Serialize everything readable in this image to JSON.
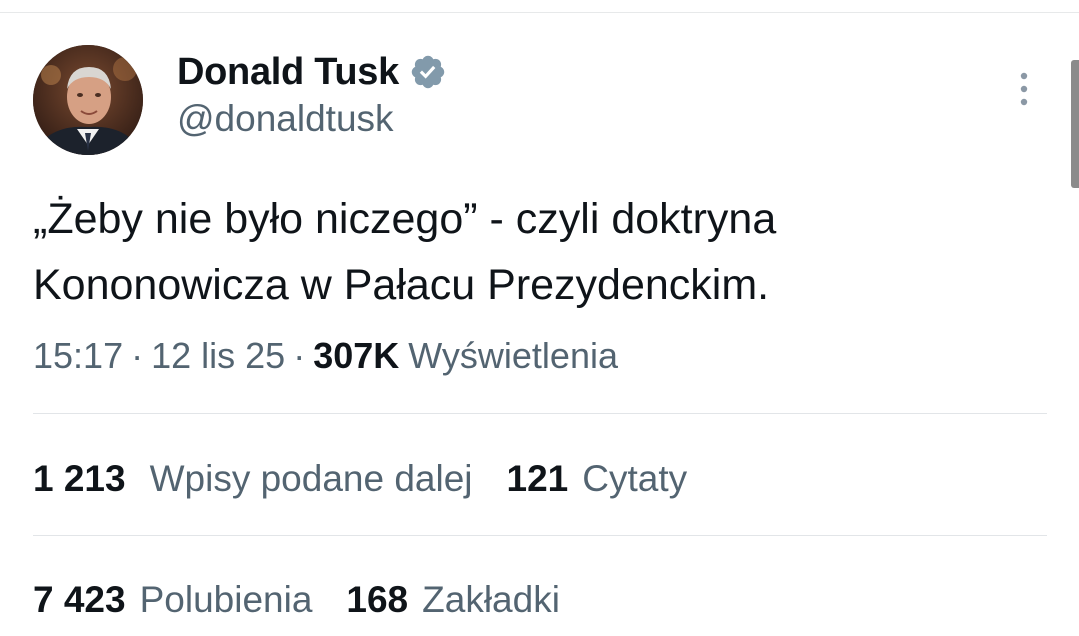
{
  "author": {
    "display_name": "Donald Tusk",
    "handle": "@donaldtusk",
    "verified_icon": "verified-badge-icon",
    "avatar_icon": "avatar-photo"
  },
  "tweet": {
    "text": "„Żeby nie było niczego” - czyli doktryna Kononowicza w Pałacu Prezydenckim."
  },
  "meta": {
    "time": "15:17",
    "separator": "·",
    "date": "12 lis 25",
    "views_count": "307K",
    "views_label": "Wyświetlenia"
  },
  "stats": {
    "reposts_count": "1 213",
    "reposts_label": "Wpisy podane dalej",
    "quotes_count": "121",
    "quotes_label": "Cytaty",
    "likes_count": "7 423",
    "likes_label": "Polubienia",
    "bookmarks_count": "168",
    "bookmarks_label": "Zakładki"
  },
  "colors": {
    "text_primary": "#0f1419",
    "text_secondary": "#536471",
    "verified_badge": "#829aab",
    "divider": "#e2e5e8"
  }
}
